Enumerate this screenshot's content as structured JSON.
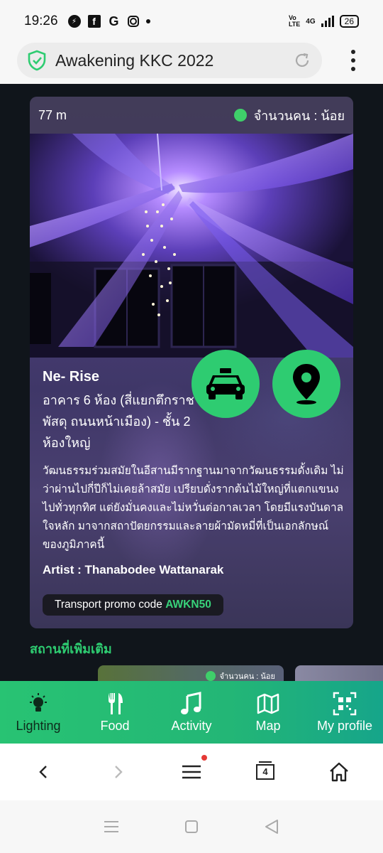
{
  "status_bar": {
    "time": "19:26",
    "notifications": [
      "messenger-icon",
      "facebook-icon",
      "g-icon",
      "instagram-icon",
      "dot"
    ],
    "network": "4G",
    "battery": "26"
  },
  "browser": {
    "title": "Awakening KKC 2022"
  },
  "card": {
    "distance": "77 m",
    "crowd": "จำนวนคน : น้อย",
    "crowd_color": "#3fcf6a",
    "name": "Ne- Rise",
    "address": "อาคาร 6 ห้อง (สี่แยกตึกราชพัสดุ ถนนหน้าเมือง) - ชั้น 2 ห้องใหญ่",
    "description": "วัฒนธรรมร่วมสมัยในอีสานมีรากฐานมาจากวัฒนธรรมดั้งเดิม ไม่ว่าผ่านไปกี่ปีก็ไม่เคยล้าสมัย เปรียบดั่งรากต้นไม้ใหญ่ที่แตกแขนงไปทั่วทุกทิศ แต่ยังมั่นคงและไม่หวั่นต่อกาลเวลา โดยมีแรงบันดาลใจหลัก มาจากสถาปัตยกรรมและลายผ้ามัดหมี่ที่เป็นเอกลักษณ์ของภูมิภาคนี้",
    "artist": "Artist : Thanabodee Wattanarak",
    "promo_label": "Transport promo code ",
    "promo_code": "AWKN50"
  },
  "more": {
    "title": "สถานที่เพิ่มเติม",
    "next_crowd": "จำนวนคน : น้อย"
  },
  "nav": {
    "items": [
      {
        "label": "Lighting",
        "icon": "bulb-icon"
      },
      {
        "label": "Food",
        "icon": "utensils-icon"
      },
      {
        "label": "Activity",
        "icon": "music-icon"
      },
      {
        "label": "Map",
        "icon": "map-icon"
      },
      {
        "label": "My profile",
        "icon": "qr-icon"
      }
    ],
    "accent": "#2ecc71"
  },
  "browser_toolbar": {
    "tab_count": "4"
  }
}
